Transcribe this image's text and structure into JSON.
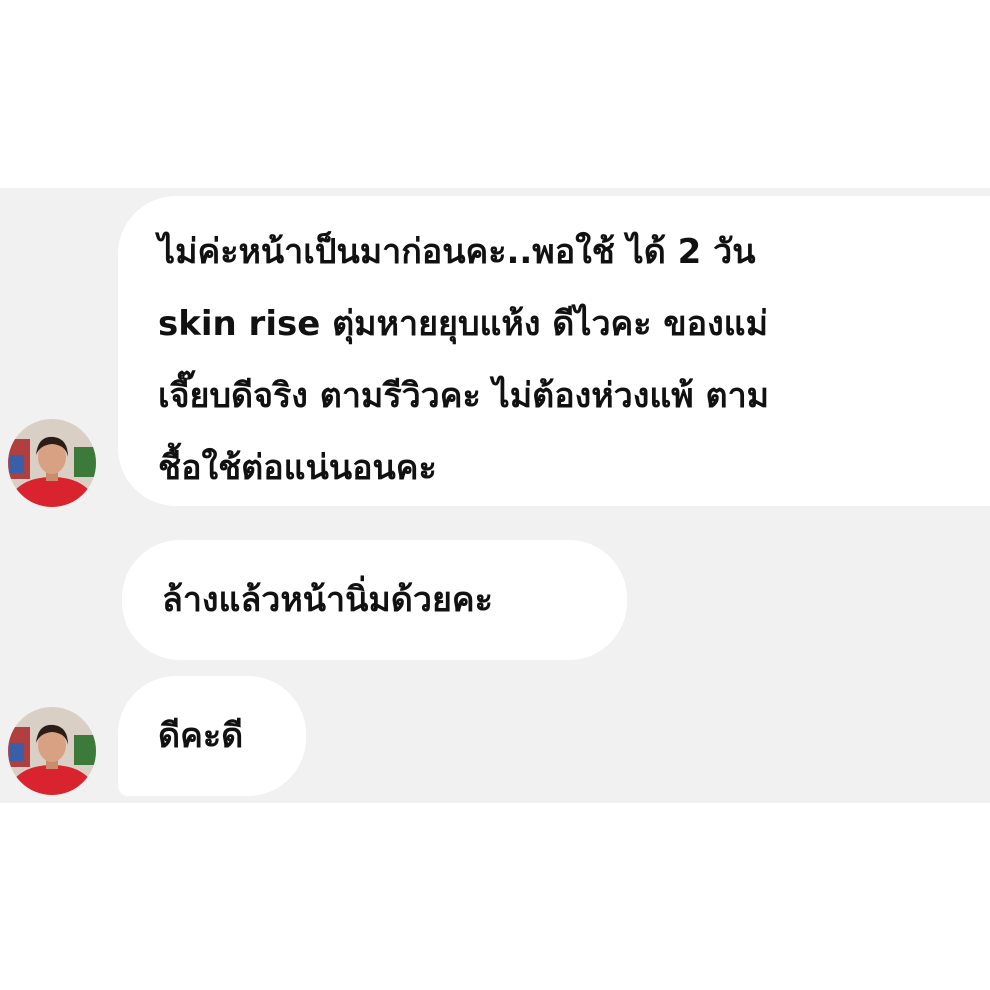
{
  "messages": [
    {
      "sender": "contact",
      "lines": [
        "ไม่ค่ะหน้าเป็นมาก่อนคะ..พอใช้ ได้ 2 วัน",
        "skin rise ตุ่มหายยุบแห้ง ดีไวคะ ของแม่",
        "เจี๊ยบดีจริง ตามรีวิวคะ ไม่ต้องห่วงแพ้ ตาม",
        "ชื้อใช้ต่อแน่นอนคะ"
      ]
    },
    {
      "sender": "contact",
      "text": "ล้างแล้วหน้านิ่มด้วยคะ"
    },
    {
      "sender": "contact",
      "text": "ดีคะดี"
    }
  ],
  "colors": {
    "chat_background": "#f1f1f1",
    "bubble": "#ffffff",
    "text": "#111111"
  }
}
